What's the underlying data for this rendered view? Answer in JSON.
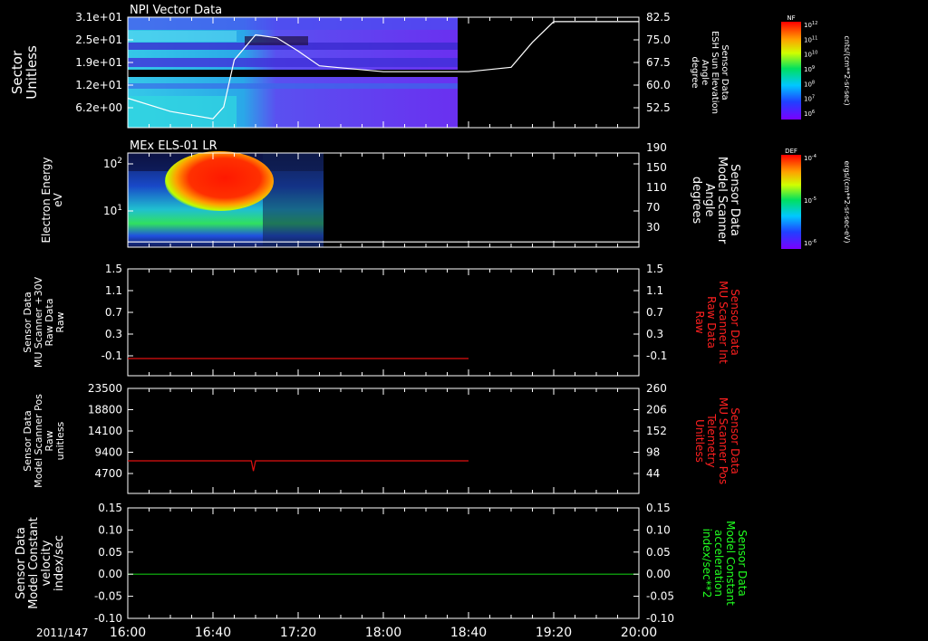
{
  "time_axis": {
    "date_label": "2011/147",
    "start": "16:00",
    "end": "20:00",
    "tick_labels": [
      "16:00",
      "16:40",
      "17:20",
      "18:00",
      "18:40",
      "19:20",
      "20:00"
    ]
  },
  "colors": {
    "trace_white": "#ffffff",
    "trace_red": "#e01010",
    "trace_green": "#10c010",
    "label_red": "#ff2020",
    "label_green": "#20ff20"
  },
  "panels": [
    {
      "id": "npi",
      "title": "NPI Vector Data",
      "left_label": [
        "Sector",
        "Unitless"
      ],
      "left_ticks": [
        "3.1e+01",
        "2.5e+01",
        "1.9e+01",
        "1.2e+01",
        "6.2e+00"
      ],
      "right_label": [
        "Sensor Data",
        "ESH Sun Elevation",
        "Angle",
        "degree"
      ],
      "right_ticks": [
        "82.5",
        "75.0",
        "67.5",
        "60.0",
        "52.5"
      ],
      "colorbar": {
        "tag": "NF",
        "unit": "cnts/(cm**2-sr-sec)",
        "tick_labels": [
          "10^12",
          "10^11",
          "10^10",
          "10^9",
          "10^8",
          "10^7",
          "10^6"
        ]
      }
    },
    {
      "id": "els",
      "title": "MEx ELS-01 LR",
      "left_label": [
        "Electron Energy",
        "eV"
      ],
      "left_ticks": [
        "10^2",
        "10^1"
      ],
      "right_label": [
        "Sensor Data",
        "Model Scanner",
        "Angle",
        "degrees"
      ],
      "right_ticks": [
        "190",
        "150",
        "110",
        "70",
        "30"
      ],
      "colorbar": {
        "tag": "DEF",
        "unit": "ergs/(cm**2-sr-sec-eV)",
        "tick_labels": [
          "10^-4",
          "10^-5",
          "10^-6"
        ]
      }
    },
    {
      "id": "mu30",
      "title": "",
      "left_label": [
        "Sensor Data",
        "MU Scanner +30V",
        "Raw Data",
        "Raw"
      ],
      "left_ticks": [
        "1.5",
        "1.1",
        "0.7",
        "0.3",
        "-0.1"
      ],
      "right_label": [
        "Sensor Data",
        "MU Scanner Int",
        "Raw Data",
        "Raw"
      ],
      "right_ticks": [
        "1.5",
        "1.1",
        "0.7",
        "0.3",
        "-0.1"
      ]
    },
    {
      "id": "pos",
      "title": "",
      "left_label": [
        "Sensor Data",
        "Model Scanner Pos",
        "Raw",
        "unitless"
      ],
      "left_ticks": [
        "23500",
        "18800",
        "14100",
        "9400",
        "4700"
      ],
      "right_label": [
        "Sensor Data",
        "MU Scanner Pos",
        "Telemetry",
        "Unitless"
      ],
      "right_ticks": [
        "260",
        "206",
        "152",
        "98",
        "44"
      ]
    },
    {
      "id": "vel",
      "title": "",
      "left_label": [
        "Sensor Data",
        "Model Constant",
        "velocity",
        "index/sec"
      ],
      "left_ticks": [
        "0.15",
        "0.10",
        "0.05",
        "0.00",
        "-0.05",
        "-0.10"
      ],
      "right_label": [
        "Sensor Data",
        "Model Constant",
        "acceleration",
        "index/sec**2"
      ],
      "right_ticks": [
        "0.15",
        "0.10",
        "0.05",
        "0.00",
        "-0.05",
        "-0.10"
      ]
    }
  ],
  "chart_data": [
    {
      "type": "heatmap",
      "title": "NPI Vector Data",
      "x_range": [
        "16:00",
        "18:40"
      ],
      "ylabel": "Sector Unitless",
      "ylim": [
        0,
        31
      ],
      "overlay_series": {
        "name": "ESH Sun Elevation Angle",
        "axis": "right",
        "ylim": [
          45,
          82.5
        ],
        "x": [
          "16:00",
          "16:20",
          "16:40",
          "16:45",
          "16:50",
          "17:00",
          "17:10",
          "17:20",
          "17:30",
          "18:00",
          "18:40",
          "19:00",
          "19:10",
          "19:20",
          "20:00"
        ],
        "values": [
          55.0,
          50.5,
          48.0,
          52.0,
          68.0,
          76.5,
          75.5,
          71.0,
          66.0,
          64.0,
          64.0,
          65.5,
          74.0,
          81.0,
          81.0
        ]
      }
    },
    {
      "type": "heatmap",
      "title": "MEx ELS-01 LR",
      "x_range": [
        "16:00",
        "17:40"
      ],
      "ylabel": "Electron Energy eV",
      "yscale": "log",
      "overlay_series": {
        "name": "Model Scanner Angle",
        "axis": "right",
        "ylim": [
          10,
          190
        ],
        "x": [
          "16:00",
          "20:00"
        ],
        "values": [
          20,
          20
        ]
      }
    },
    {
      "type": "line",
      "ylim": [
        -0.3,
        1.5
      ],
      "series": [
        {
          "axis": "left",
          "x": [
            "16:00",
            "18:40"
          ],
          "values": [
            -0.01,
            -0.01
          ]
        }
      ]
    },
    {
      "type": "line",
      "ylim": [
        0,
        23500
      ],
      "series": [
        {
          "axis": "left",
          "x": [
            "16:00",
            "16:58",
            "16:59",
            "17:00",
            "18:40"
          ],
          "values": [
            7300,
            7300,
            5000,
            7300,
            7300
          ]
        }
      ]
    },
    {
      "type": "line",
      "ylim": [
        -0.1,
        0.15
      ],
      "series": [
        {
          "axis": "left",
          "x": [
            "16:00",
            "20:00"
          ],
          "values": [
            0.0,
            0.0
          ]
        }
      ]
    }
  ]
}
